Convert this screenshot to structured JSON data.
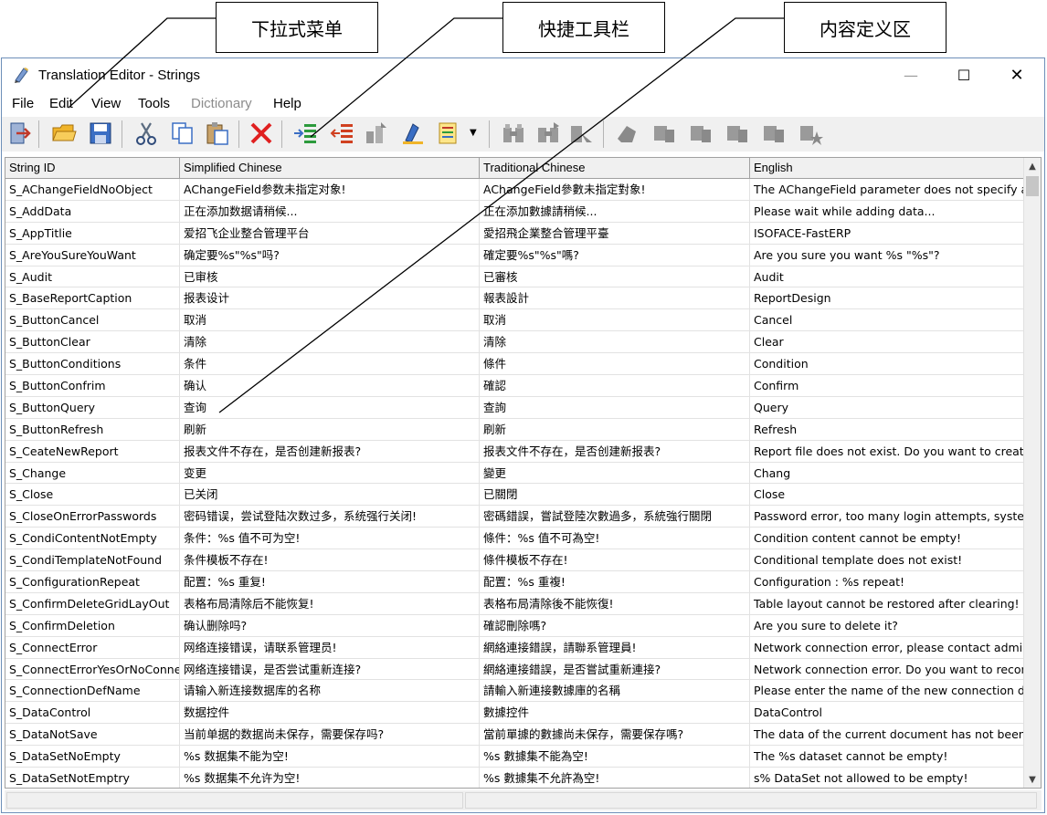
{
  "callouts": {
    "dropdown_menu": "下拉式菜单",
    "quick_toolbar": "快捷工具栏",
    "content_area": "内容定义区"
  },
  "window": {
    "title": "Translation Editor - Strings",
    "minimize": "—",
    "maximize": "☐",
    "close": "✕"
  },
  "menu": {
    "items": [
      {
        "label": "File",
        "enabled": true
      },
      {
        "label": "Edit",
        "enabled": true
      },
      {
        "label": "View",
        "enabled": true
      },
      {
        "label": "Tools",
        "enabled": true
      },
      {
        "label": "Dictionary",
        "enabled": false
      },
      {
        "label": "Help",
        "enabled": true
      }
    ]
  },
  "toolbar": {
    "buttons": [
      {
        "name": "exit-icon",
        "enabled": true
      },
      {
        "name": "open-folder-icon",
        "enabled": true
      },
      {
        "name": "save-icon",
        "enabled": true
      },
      {
        "name": "cut-icon",
        "enabled": true
      },
      {
        "name": "copy-icon",
        "enabled": true
      },
      {
        "name": "paste-icon",
        "enabled": true
      },
      {
        "name": "delete-icon",
        "enabled": true
      },
      {
        "name": "indent-icon",
        "enabled": true
      },
      {
        "name": "outdent-icon",
        "enabled": true
      },
      {
        "name": "move-icon",
        "enabled": false
      },
      {
        "name": "highlight-icon",
        "enabled": true
      },
      {
        "name": "list-dropdown-icon",
        "enabled": true
      },
      {
        "name": "find-icon",
        "enabled": false
      },
      {
        "name": "find-next-icon",
        "enabled": false
      },
      {
        "name": "find-prev-icon",
        "enabled": false
      },
      {
        "name": "bookmark-icon",
        "enabled": false
      },
      {
        "name": "nav-first-icon",
        "enabled": false
      },
      {
        "name": "nav-prev-icon",
        "enabled": false
      },
      {
        "name": "nav-next-icon",
        "enabled": false
      },
      {
        "name": "nav-last-icon",
        "enabled": false
      },
      {
        "name": "nav-star-icon",
        "enabled": false
      }
    ]
  },
  "grid": {
    "columns": [
      "String ID",
      "Simplified Chinese",
      "Traditional Chinese",
      "English"
    ],
    "rows": [
      [
        "S_AChangeFieldNoObject",
        "AChangeField参数未指定对象!",
        "AChangeField參數未指定對象!",
        "The AChangeField parameter does not specify ar"
      ],
      [
        "S_AddData",
        "正在添加数据请稍候...",
        "正在添加數據請稍候...",
        "Please wait while adding data..."
      ],
      [
        "S_AppTitlie",
        "爱招飞企业整合管理平台",
        "愛招飛企業整合管理平臺",
        "ISOFACE-FastERP"
      ],
      [
        "S_AreYouSureYouWant",
        "确定要%s\"%s\"吗?",
        "確定要%s\"%s\"嗎?",
        "Are you sure you want %s \"%s\"?"
      ],
      [
        "S_Audit",
        "已审核",
        "已審核",
        "Audit"
      ],
      [
        "S_BaseReportCaption",
        "报表设计",
        "報表設計",
        "ReportDesign"
      ],
      [
        "S_ButtonCancel",
        "取消",
        "取消",
        "Cancel"
      ],
      [
        "S_ButtonClear",
        "清除",
        "清除",
        "Clear"
      ],
      [
        "S_ButtonConditions",
        "条件",
        "條件",
        "Condition"
      ],
      [
        "S_ButtonConfrim",
        "确认",
        "確認",
        "Confirm"
      ],
      [
        "S_ButtonQuery",
        "查询",
        "查詢",
        "Query"
      ],
      [
        "S_ButtonRefresh",
        "刷新",
        "刷新",
        "Refresh"
      ],
      [
        "S_CeateNewReport",
        "报表文件不存在，是否创建新报表?",
        "报表文件不存在，是否创建新报表?",
        "Report file does not exist. Do you want to create"
      ],
      [
        "S_Change",
        "变更",
        "變更",
        "Chang"
      ],
      [
        "S_Close",
        "已关闭",
        "已關閉",
        "Close"
      ],
      [
        "S_CloseOnErrorPasswords",
        "密码错误，尝试登陆次数过多，系统强行关闭!",
        "密碼錯誤，嘗試登陸次數過多，系統強行關閉",
        "Password error, too many login attempts, system"
      ],
      [
        "S_CondiContentNotEmpty",
        "条件：%s 值不可为空!",
        "條件：%s 值不可為空!",
        "Condition content cannot be empty!"
      ],
      [
        "S_CondiTemplateNotFound",
        "条件模板不存在!",
        "條件模板不存在!",
        "Conditional template does not exist!"
      ],
      [
        "S_ConfigurationRepeat",
        "配置：%s 重复!",
        "配置：%s 重複!",
        "Configuration : %s  repeat!"
      ],
      [
        "S_ConfirmDeleteGridLayOut",
        "表格布局清除后不能恢复!",
        "表格布局清除後不能恢復!",
        "Table layout cannot be restored after clearing!"
      ],
      [
        "S_ConfirmDeletion",
        "确认删除吗?",
        "確認刪除嗎?",
        "Are you sure to delete it?"
      ],
      [
        "S_ConnectError",
        "网络连接错误，请联系管理员!",
        "網絡連接錯誤，請聯系管理員!",
        "Network connection error, please contact adminis"
      ],
      [
        "S_ConnectErrorYesOrNoConne",
        "网络连接错误，是否尝试重新连接?",
        "網絡連接錯誤，是否嘗試重新連接?",
        "Network connection error. Do you want to reconn"
      ],
      [
        "S_ConnectionDefName",
        "请输入新连接数据库的名称",
        "請輸入新連接數據庫的名稱",
        "Please enter the name of the new connection da"
      ],
      [
        "S_DataControl",
        "数据控件",
        "數據控件",
        "DataControl"
      ],
      [
        "S_DataNotSave",
        "当前单据的数据尚未保存，需要保存吗?",
        "當前單據的數據尚未保存，需要保存嗎?",
        "The data of the current document has not been s"
      ],
      [
        "S_DataSetNoEmpty",
        "%s 数据集不能为空!",
        "%s 數據集不能為空!",
        "The %s dataset cannot be empty!"
      ],
      [
        "S_DataSetNotEmptry",
        "%s 数据集不允许为空!",
        "%s 數據集不允許為空!",
        "s% DataSet not allowed to be empty!"
      ]
    ]
  },
  "scrollbar": {
    "up_arrow": "▲",
    "down_arrow": "▼"
  }
}
